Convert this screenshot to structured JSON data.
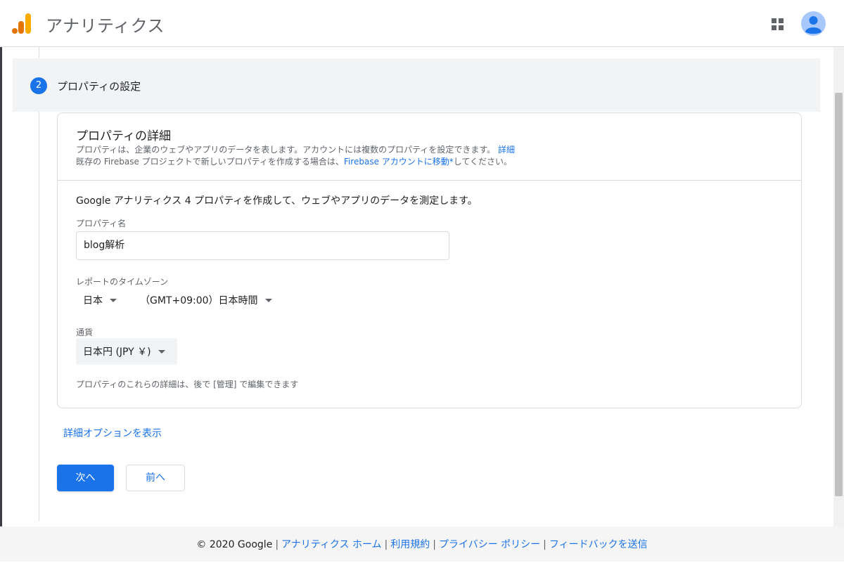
{
  "header": {
    "app_title": "アナリティクス"
  },
  "step": {
    "number": "2",
    "title": "プロパティの設定"
  },
  "card": {
    "title": "プロパティの詳細",
    "desc_line1": "プロパティは、企業のウェブやアプリのデータを表します。アカウントには複数のプロパティを設定できます。",
    "desc_link1": "詳細",
    "desc_line2_prefix": "既存の Firebase プロジェクトで新しいプロパティを作成する場合は、",
    "desc_link2": "Firebase アカウントに移動*",
    "desc_line2_suffix": "してください。",
    "intro": "Google アナリティクス 4 プロパティを作成して、ウェブやアプリのデータを測定します。",
    "property_name_label": "プロパティ名",
    "property_name_value": "blog解析",
    "timezone_label": "レポートのタイムゾーン",
    "timezone_country": "日本",
    "timezone_value": "（GMT+09:00）日本時間",
    "currency_label": "通貨",
    "currency_value": "日本円 (JPY ￥)",
    "note": "プロパティのこれらの詳細は、後で [管理] で編集できます"
  },
  "advanced_link": "詳細オプションを表示",
  "buttons": {
    "next": "次へ",
    "prev": "前へ"
  },
  "footer": {
    "copyright": "© 2020 Google",
    "links": [
      "アナリティクス ホーム",
      "利用規約",
      "プライバシー ポリシー",
      "フィードバックを送信"
    ],
    "separator": "|"
  },
  "colors": {
    "accent": "#1a73e8",
    "logo_orange": "#f9ab00",
    "logo_dark_orange": "#e37400"
  }
}
